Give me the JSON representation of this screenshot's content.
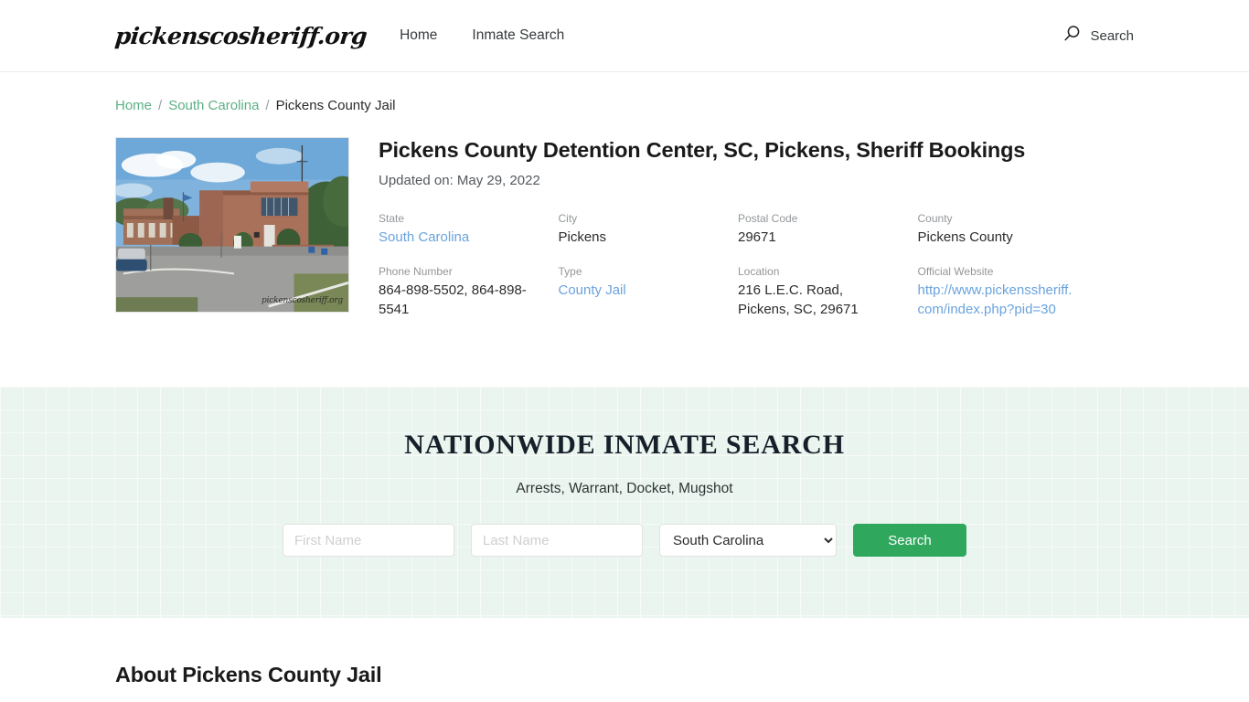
{
  "header": {
    "brand": "pickenscosheriff.org",
    "nav": [
      {
        "label": "Home"
      },
      {
        "label": "Inmate Search"
      }
    ],
    "search_label": "Search",
    "search_icon": "search-icon"
  },
  "breadcrumb": {
    "items": [
      {
        "label": "Home",
        "type": "link"
      },
      {
        "label": "South Carolina",
        "type": "link"
      },
      {
        "label": "Pickens County Jail",
        "type": "current"
      }
    ],
    "separator": "/"
  },
  "facility": {
    "title": "Pickens County Detention Center, SC, Pickens, Sheriff Bookings",
    "updated": "Updated on: May 29, 2022",
    "image_watermark": "pickenscosheriff.org",
    "fields": [
      {
        "label": "State",
        "value": "South Carolina",
        "is_link": true
      },
      {
        "label": "City",
        "value": "Pickens",
        "is_link": false
      },
      {
        "label": "Postal Code",
        "value": "29671",
        "is_link": false
      },
      {
        "label": "County",
        "value": "Pickens County",
        "is_link": false
      },
      {
        "label": "Phone Number",
        "value": "864-898-5502, 864-898-5541",
        "is_link": false
      },
      {
        "label": "Type",
        "value": "County Jail",
        "is_link": true
      },
      {
        "label": "Location",
        "value": "216 L.E.C. Road, Pickens, SC, 29671",
        "is_link": false
      },
      {
        "label": "Official Website",
        "value": "http://www.pickenssheriff.com/index.php?pid=30",
        "is_link": true
      }
    ]
  },
  "nationwide_search": {
    "title": "NATIONWIDE INMATE SEARCH",
    "subtitle": "Arrests, Warrant, Docket, Mugshot",
    "first_name_placeholder": "First Name",
    "first_name_value": "",
    "last_name_placeholder": "Last Name",
    "last_name_value": "",
    "state_selected": "South Carolina",
    "state_options": [
      "South Carolina"
    ],
    "submit_label": "Search"
  },
  "about": {
    "heading": "About Pickens County Jail"
  },
  "colors": {
    "accent_green": "#2fa85e",
    "breadcrumb_link": "#5cb085",
    "link_blue": "#6aa3dd",
    "band_background": "#e9f5ee",
    "label_gray": "#939699"
  }
}
